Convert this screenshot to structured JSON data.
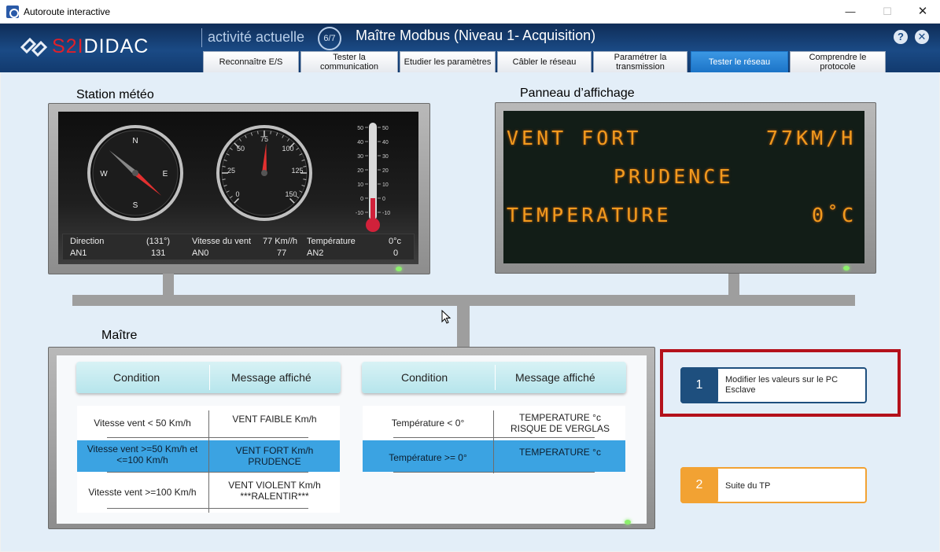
{
  "window": {
    "title": "Autoroute interactive"
  },
  "header": {
    "logo_prefix": "S2I",
    "logo_suffix": "DIDAC",
    "activity_label": "activité actuelle",
    "step": "6/7",
    "module_title": "Maître Modbus (Niveau 1- Acquisition)",
    "help_icon": "?",
    "close_icon": "✕"
  },
  "tabs": [
    {
      "label": "Reconnaître E/S"
    },
    {
      "label": "Tester la communication"
    },
    {
      "label": "Etudier les paramètres"
    },
    {
      "label": "Câbler le réseau"
    },
    {
      "label": "Paramétrer la transmission"
    },
    {
      "label": "Tester le réseau",
      "active": true
    },
    {
      "label": "Comprendre le protocole"
    }
  ],
  "station": {
    "title": "Station météo",
    "compass_labels": [
      "N",
      "E",
      "S",
      "W"
    ],
    "speed_scale": [
      "0",
      "25",
      "50",
      "75",
      "100",
      "125",
      "150"
    ],
    "thermo_scale": [
      "50",
      "40",
      "30",
      "20",
      "10",
      "0",
      "-10"
    ],
    "readout": {
      "direction_label": "Direction",
      "direction_value": "(131°)",
      "an1_label": "AN1",
      "an1_value": "131",
      "speed_label": "Vitesse du vent",
      "speed_value": "77 Km//h",
      "an0_label": "AN0",
      "an0_value": "77",
      "temp_label": "Température",
      "temp_value": "0°c",
      "an2_label": "AN2",
      "an2_value": "0"
    },
    "direction_deg": 131,
    "speed_kmh": 77,
    "temperature_c": 0
  },
  "panel": {
    "title": "Panneau d’affichage",
    "line1_left": "VENT FORT",
    "line1_right": "77KM/H",
    "line2": "PRUDENCE",
    "line3_left": "TEMPERATURE",
    "line3_right": "0˚C"
  },
  "master": {
    "title": "Maître",
    "wind_table": {
      "col_condition": "Condition",
      "col_message": "Message affiché",
      "rows": [
        {
          "condition": "Vitesse vent < 50 Km/h",
          "message": "VENT FAIBLE    Km/h"
        },
        {
          "condition": "Vitesse vent >=50 Km/h et <=100 Km/h",
          "message": "VENT FORT     Km/h PRUDENCE"
        },
        {
          "condition": "Vitesste vent >=100 Km/h",
          "message": "VENT VIOLENT     Km/h ***RALENTIR***"
        }
      ]
    },
    "temp_table": {
      "col_condition": "Condition",
      "col_message": "Message affiché",
      "rows": [
        {
          "condition": "Température  < 0°",
          "message": "TEMPERATURE     °c RISQUE DE VERGLAS"
        },
        {
          "condition": "Température >= 0°",
          "message": "TEMPERATURE     °c"
        }
      ]
    }
  },
  "actions": [
    {
      "number": "1",
      "label": "Modifier les valeurs sur le PC Esclave"
    },
    {
      "number": "2",
      "label": "Suite du TP"
    }
  ],
  "colors": {
    "header": "#1a4a85",
    "accent": "#3ba3e2",
    "action1": "#1e4f7e",
    "action2": "#f2a233",
    "highlight": "#b4111b",
    "led": "#f29a1e"
  }
}
